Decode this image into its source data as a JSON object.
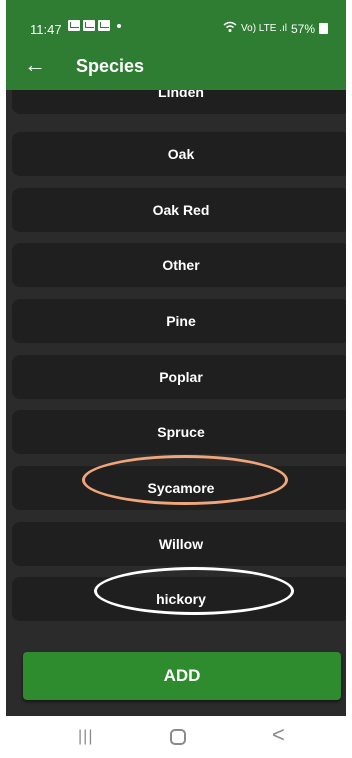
{
  "status_bar": {
    "time": "11:47",
    "battery": "57%",
    "signal_text": "Vo) LTE .ıl"
  },
  "app_bar": {
    "back_icon": "←",
    "title": "Species"
  },
  "species_list": [
    "Linden",
    "Oak",
    "Oak Red",
    "Other",
    "Pine",
    "Poplar",
    "Spruce",
    "Sycamore",
    "Willow",
    "hickory"
  ],
  "add_button": {
    "label": "ADD"
  },
  "nav": {
    "recents": "|||",
    "back": "<"
  },
  "colors": {
    "accent": "#2e7d32",
    "background": "#2b2b2b",
    "row": "#1f1f1f",
    "highlight_orange": "#f0a57a",
    "highlight_white": "#ffffff"
  },
  "icons": {
    "back": "arrow-left-icon",
    "notifications": [
      "mail-icon",
      "image-icon",
      "check-icon"
    ],
    "status": [
      "wifi-icon",
      "signal-icon",
      "battery-icon"
    ]
  }
}
